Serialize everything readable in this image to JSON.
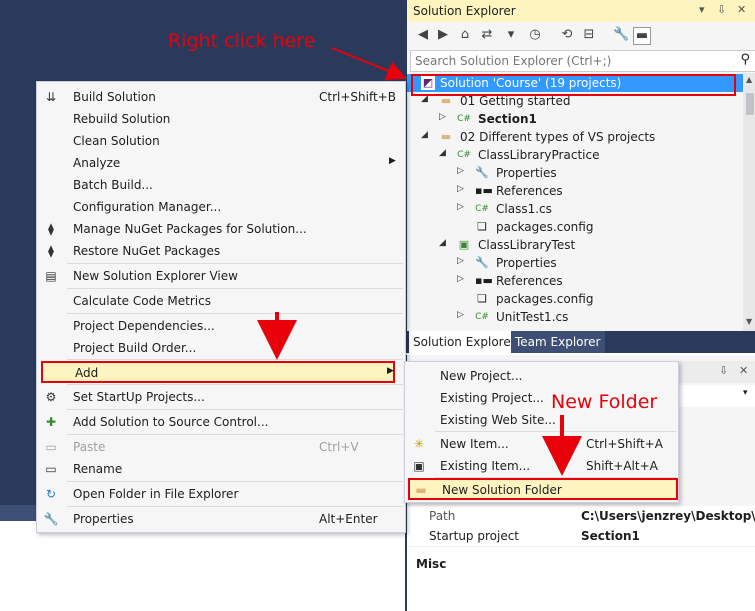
{
  "annotations": {
    "right_click": "Right click here",
    "new_folder": "New Folder",
    "color": "#e8000b"
  },
  "solution_explorer": {
    "title": "Solution Explorer",
    "title_controls": [
      "▾",
      "⇩",
      "✕"
    ],
    "search_placeholder": "Search Solution Explorer (Ctrl+;)",
    "tree": [
      {
        "label": "Solution 'Course' (19 projects)",
        "icon": "solution-icon",
        "selected": true
      },
      {
        "label": "01 Getting started",
        "icon": "folder-icon"
      },
      {
        "label": "Section1",
        "icon": "csharp-project-icon",
        "bold": true
      },
      {
        "label": "02 Different types of VS projects",
        "icon": "folder-icon"
      },
      {
        "label": "ClassLibraryPractice",
        "icon": "csharp-project-icon"
      },
      {
        "label": "Properties",
        "icon": "wrench-icon"
      },
      {
        "label": "References",
        "icon": "references-icon"
      },
      {
        "label": "Class1.cs",
        "icon": "csharp-file-icon"
      },
      {
        "label": "packages.config",
        "icon": "config-file-icon"
      },
      {
        "label": "ClassLibraryTest",
        "icon": "test-project-icon"
      },
      {
        "label": "Properties",
        "icon": "wrench-icon"
      },
      {
        "label": "References",
        "icon": "references-icon"
      },
      {
        "label": "packages.config",
        "icon": "config-file-icon"
      },
      {
        "label": "UnitTest1.cs",
        "icon": "csharp-file-icon"
      }
    ],
    "tabs": [
      "Solution Explorer",
      "Team Explorer"
    ],
    "accent": "#3399ff",
    "title_bg": "#fdf4bf"
  },
  "properties": {
    "rows": [
      {
        "key": "Path",
        "value": "C:\\Users\\jenzrey\\Desktop\\CSha"
      },
      {
        "key": "Startup project",
        "value": "Section1"
      }
    ],
    "section": "Misc"
  },
  "context_menu": {
    "items": [
      {
        "label": "Build Solution",
        "shortcut": "Ctrl+Shift+B",
        "icon": "build-icon"
      },
      {
        "label": "Rebuild Solution",
        "shortcut": "",
        "icon": ""
      },
      {
        "label": "Clean Solution",
        "shortcut": "",
        "icon": ""
      },
      {
        "label": "Analyze",
        "shortcut": "",
        "icon": "",
        "submenu": true
      },
      {
        "label": "Batch Build...",
        "shortcut": "",
        "icon": ""
      },
      {
        "label": "Configuration Manager...",
        "shortcut": "",
        "icon": ""
      },
      {
        "label": "Manage NuGet Packages for Solution...",
        "shortcut": "",
        "icon": "nuget-icon"
      },
      {
        "label": "Restore NuGet Packages",
        "shortcut": "",
        "icon": "restore-icon"
      },
      {
        "label": "New Solution Explorer View",
        "shortcut": "",
        "icon": "new-view-icon"
      },
      {
        "label": "Calculate Code Metrics",
        "shortcut": "",
        "icon": ""
      },
      {
        "label": "Project Dependencies...",
        "shortcut": "",
        "icon": ""
      },
      {
        "label": "Project Build Order...",
        "shortcut": "",
        "icon": ""
      },
      {
        "label": "Add",
        "shortcut": "",
        "icon": "",
        "submenu": true
      },
      {
        "label": "Set StartUp Projects...",
        "shortcut": "",
        "icon": "gear-icon"
      },
      {
        "label": "Add Solution to Source Control...",
        "shortcut": "",
        "icon": "source-control-icon"
      },
      {
        "label": "Paste",
        "shortcut": "Ctrl+V",
        "icon": "paste-icon",
        "disabled": true
      },
      {
        "label": "Rename",
        "shortcut": "",
        "icon": "rename-icon"
      },
      {
        "label": "Open Folder in File Explorer",
        "shortcut": "",
        "icon": "open-folder-icon"
      },
      {
        "label": "Properties",
        "shortcut": "Alt+Enter",
        "icon": "wrench-icon"
      }
    ]
  },
  "add_submenu": {
    "items": [
      {
        "label": "New Project...",
        "shortcut": ""
      },
      {
        "label": "Existing Project...",
        "shortcut": ""
      },
      {
        "label": "Existing Web Site...",
        "shortcut": ""
      },
      {
        "label": "New Item...",
        "shortcut": "Ctrl+Shift+A"
      },
      {
        "label": "Existing Item...",
        "shortcut": "Shift+Alt+A"
      },
      {
        "label": "New Solution Folder",
        "shortcut": ""
      }
    ]
  }
}
